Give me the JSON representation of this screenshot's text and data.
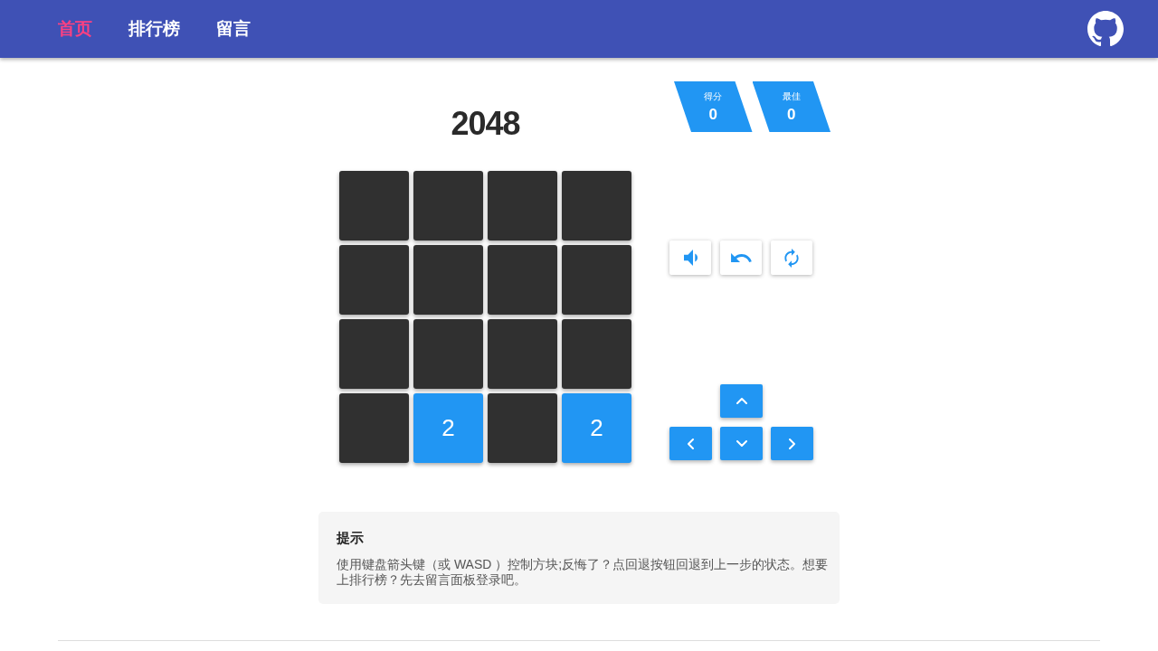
{
  "nav": {
    "items": [
      {
        "label": "首页",
        "selected": true
      },
      {
        "label": "排行榜",
        "selected": false
      },
      {
        "label": "留言",
        "selected": false
      }
    ]
  },
  "game": {
    "title": "2048",
    "scores": [
      {
        "label": "得分",
        "value": "0"
      },
      {
        "label": "最佳",
        "value": "0"
      }
    ],
    "board": [
      [
        {
          "kind": "empty"
        },
        {
          "kind": "empty"
        },
        {
          "kind": "empty"
        },
        {
          "kind": "empty"
        }
      ],
      [
        {
          "kind": "empty"
        },
        {
          "kind": "empty"
        },
        {
          "kind": "empty"
        },
        {
          "kind": "empty"
        }
      ],
      [
        {
          "kind": "empty"
        },
        {
          "kind": "empty"
        },
        {
          "kind": "empty"
        },
        {
          "kind": "empty"
        }
      ],
      [
        {
          "kind": "empty"
        },
        {
          "kind": "number",
          "value": "2"
        },
        {
          "kind": "empty"
        },
        {
          "kind": "number",
          "value": "2"
        }
      ]
    ]
  },
  "hint": {
    "title": "提示",
    "text": "使用键盘箭头键（或 WASD ）控制方块;反悔了？点回退按钮回退到上一步的状态。想要上排行榜？先去留言面板登录吧。"
  }
}
